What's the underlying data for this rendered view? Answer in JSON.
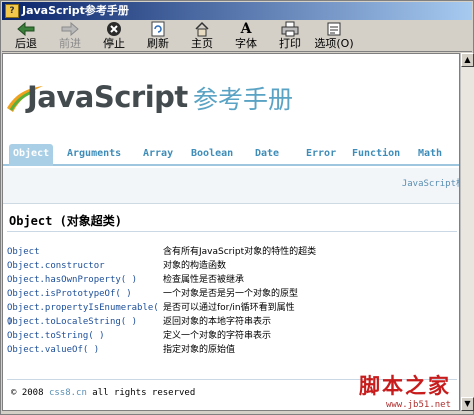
{
  "window": {
    "title": "JavaScript参考手册",
    "title_icon": "book-icon"
  },
  "toolbar": {
    "buttons": [
      {
        "label": "后退",
        "icon": "back-arrow-icon",
        "enabled": true
      },
      {
        "label": "前进",
        "icon": "forward-arrow-icon",
        "enabled": false
      },
      {
        "label": "停止",
        "icon": "stop-icon",
        "enabled": true
      },
      {
        "label": "刷新",
        "icon": "refresh-icon",
        "enabled": true
      },
      {
        "label": "主页",
        "icon": "home-icon",
        "enabled": true
      },
      {
        "label": "字体",
        "icon": "font-icon",
        "enabled": true
      },
      {
        "label": "打印",
        "icon": "print-icon",
        "enabled": true
      },
      {
        "label": "选项(O)",
        "icon": "options-icon",
        "enabled": true
      }
    ]
  },
  "header": {
    "logo_text": "JavaScript",
    "logo_sub": "参考手册"
  },
  "nav": {
    "tabs": [
      "Object",
      "Arguments",
      "Array",
      "Boolean",
      "Date",
      "Error",
      "Function",
      "Math"
    ],
    "active": "Object"
  },
  "breadcrumb": "JavaScript核",
  "page": {
    "title": "Object (对象超类)",
    "rows": [
      {
        "name": "Object",
        "desc": "含有所有JavaScript对象的特性的超类"
      },
      {
        "name": "Object.constructor",
        "desc": "对象的构造函数"
      },
      {
        "name": "Object.hasOwnProperty( )",
        "desc": "检查属性是否被继承"
      },
      {
        "name": "Object.isPrototypeOf( )",
        "desc": "一个对象是否是另一个对象的原型"
      },
      {
        "name": "Object.propertyIsEnumerable( )",
        "desc": "是否可以通过for/in循环看到属性"
      },
      {
        "name": "Object.toLocaleString( )",
        "desc": "返回对象的本地字符串表示"
      },
      {
        "name": "Object.toString( )",
        "desc": "定义一个对象的字符串表示"
      },
      {
        "name": "Object.valueOf( )",
        "desc": "指定对象的原始值"
      }
    ]
  },
  "footer": {
    "copy": "© 2008",
    "link": "css8.cn",
    "rest": "all rights reserved"
  },
  "watermark": {
    "big": "脚本之家",
    "small": "www.jb51.net"
  },
  "colors": {
    "tab_text": "#3e8cb8",
    "tab_active_bg": "#a9cfe6",
    "member_text": "#1d4f9a",
    "title_bar": "#0a246a"
  }
}
